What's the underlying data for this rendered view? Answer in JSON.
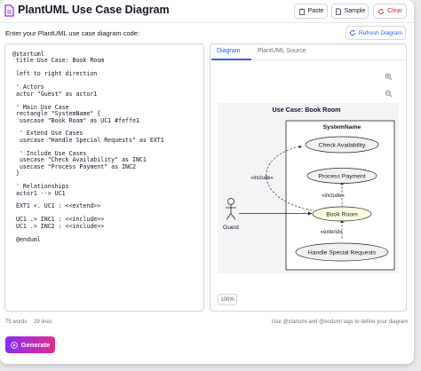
{
  "header": {
    "title": "PlantUML Use Case Diagram",
    "paste_label": "Paste",
    "sample_label": "Sample",
    "clear_label": "Clear",
    "logo_icon": "document-icon",
    "colors": {
      "accent": "#8b2cf5",
      "clear": "#dc2626"
    }
  },
  "editor": {
    "prompt": "Enter your PlantUML use case diagram code:",
    "code": "@startuml\n title Use Case: Book Room\n\n left to right direction\n\n ' Actors\n actor \"Guest\" as actor1\n\n ' Main Use Case\n rectangle \"SystemName\" {\n  usecase \"Book Room\" as UC1 #feffe1\n\n  ' Extend Use Cases\n  usecase \"Handle Special Requests\" as EXT1\n\n  ' Include Use Cases\n  usecase \"Check Availability\" as INC1\n  usecase \"Process Payment\" as INC2\n }\n\n ' Relationships\n actor1 --> UC1\n\n EXT1 <. UC1 : <<extend>>\n\n UC1 .> INC1 : <<include>>\n UC1 .> INC2 : <<include>>\n\n @enduml"
  },
  "preview": {
    "refresh_label": "Refresh Diagram",
    "tabs": [
      {
        "label": "Diagram",
        "active": true
      },
      {
        "label": "PlantUML Source",
        "active": false
      }
    ],
    "zoom_level": "100%",
    "tools": [
      "zoom-in-icon",
      "zoom-out-icon",
      "reset-icon",
      "expand-icon",
      "fullscreen-icon"
    ]
  },
  "diagram": {
    "title": "Use Case: Book Room",
    "system_name": "SystemName",
    "actor": "Guest",
    "usecases": {
      "check": "Check Availability",
      "payment": "Process Payment",
      "book": "Book Room",
      "special": "Handle Special Requests"
    },
    "include_label": "«include»",
    "extend_label": "«extend»",
    "colors": {
      "book_fill": "#feffe1",
      "usecase_fill": "#f1f1f1"
    }
  },
  "footer": {
    "words": "75 words",
    "lines": "29 lines",
    "hint": "Use @startuml and @enduml tags to define your diagram"
  },
  "generate_label": "Generate"
}
